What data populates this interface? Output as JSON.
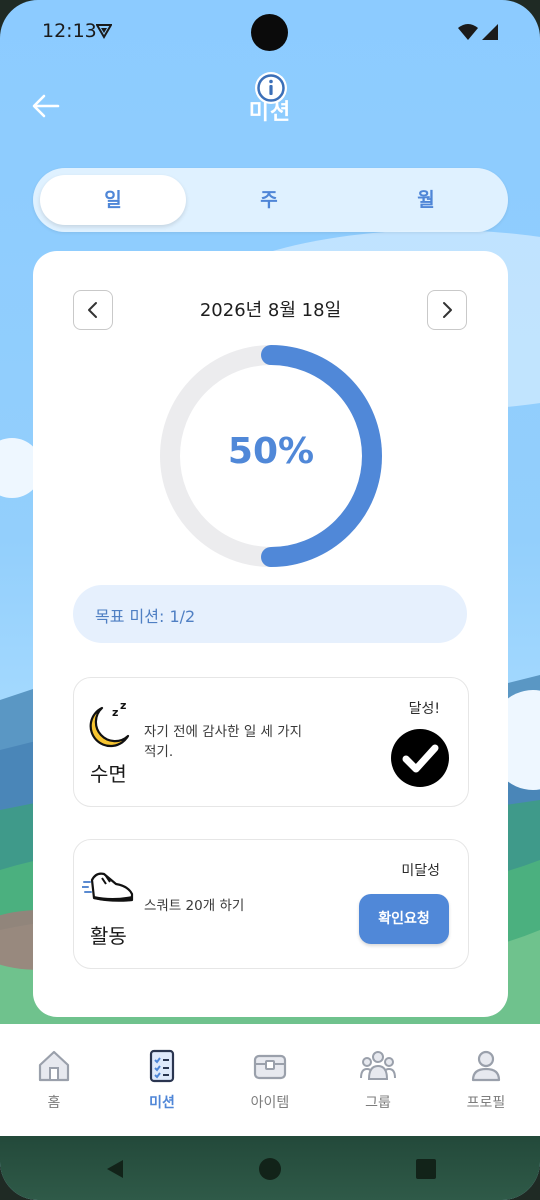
{
  "status_bar": {
    "time": "12:13"
  },
  "header": {
    "title": "미션"
  },
  "tabs": [
    {
      "label": "일",
      "active": true
    },
    {
      "label": "주",
      "active": false
    },
    {
      "label": "월",
      "active": false
    }
  ],
  "date_card": {
    "date": "2026년 8월 18일",
    "progress_percent_label": "50%",
    "progress_fraction": 0.5,
    "goal_text": "목표 미션: 1/2"
  },
  "missions": [
    {
      "category": "수면",
      "description": "자기 전에 감사한 일 세 가지 적기.",
      "status": "달성!",
      "icon": "moon-sleep-icon"
    },
    {
      "category": "활동",
      "description": "스쿼트 20개 하기",
      "status": "미달성",
      "action": "확인요청",
      "icon": "sneaker-icon"
    }
  ],
  "bottom_nav": [
    {
      "label": "홈",
      "icon": "home-icon",
      "active": false
    },
    {
      "label": "미션",
      "icon": "mission-checklist-icon",
      "active": true
    },
    {
      "label": "아이템",
      "icon": "item-chest-icon",
      "active": false
    },
    {
      "label": "그룹",
      "icon": "group-icon",
      "active": false
    },
    {
      "label": "프로필",
      "icon": "profile-icon",
      "active": false
    }
  ],
  "colors": {
    "accent": "#5088d8",
    "background": "#8ccbff",
    "card": "#ffffff",
    "done": "#000000"
  }
}
